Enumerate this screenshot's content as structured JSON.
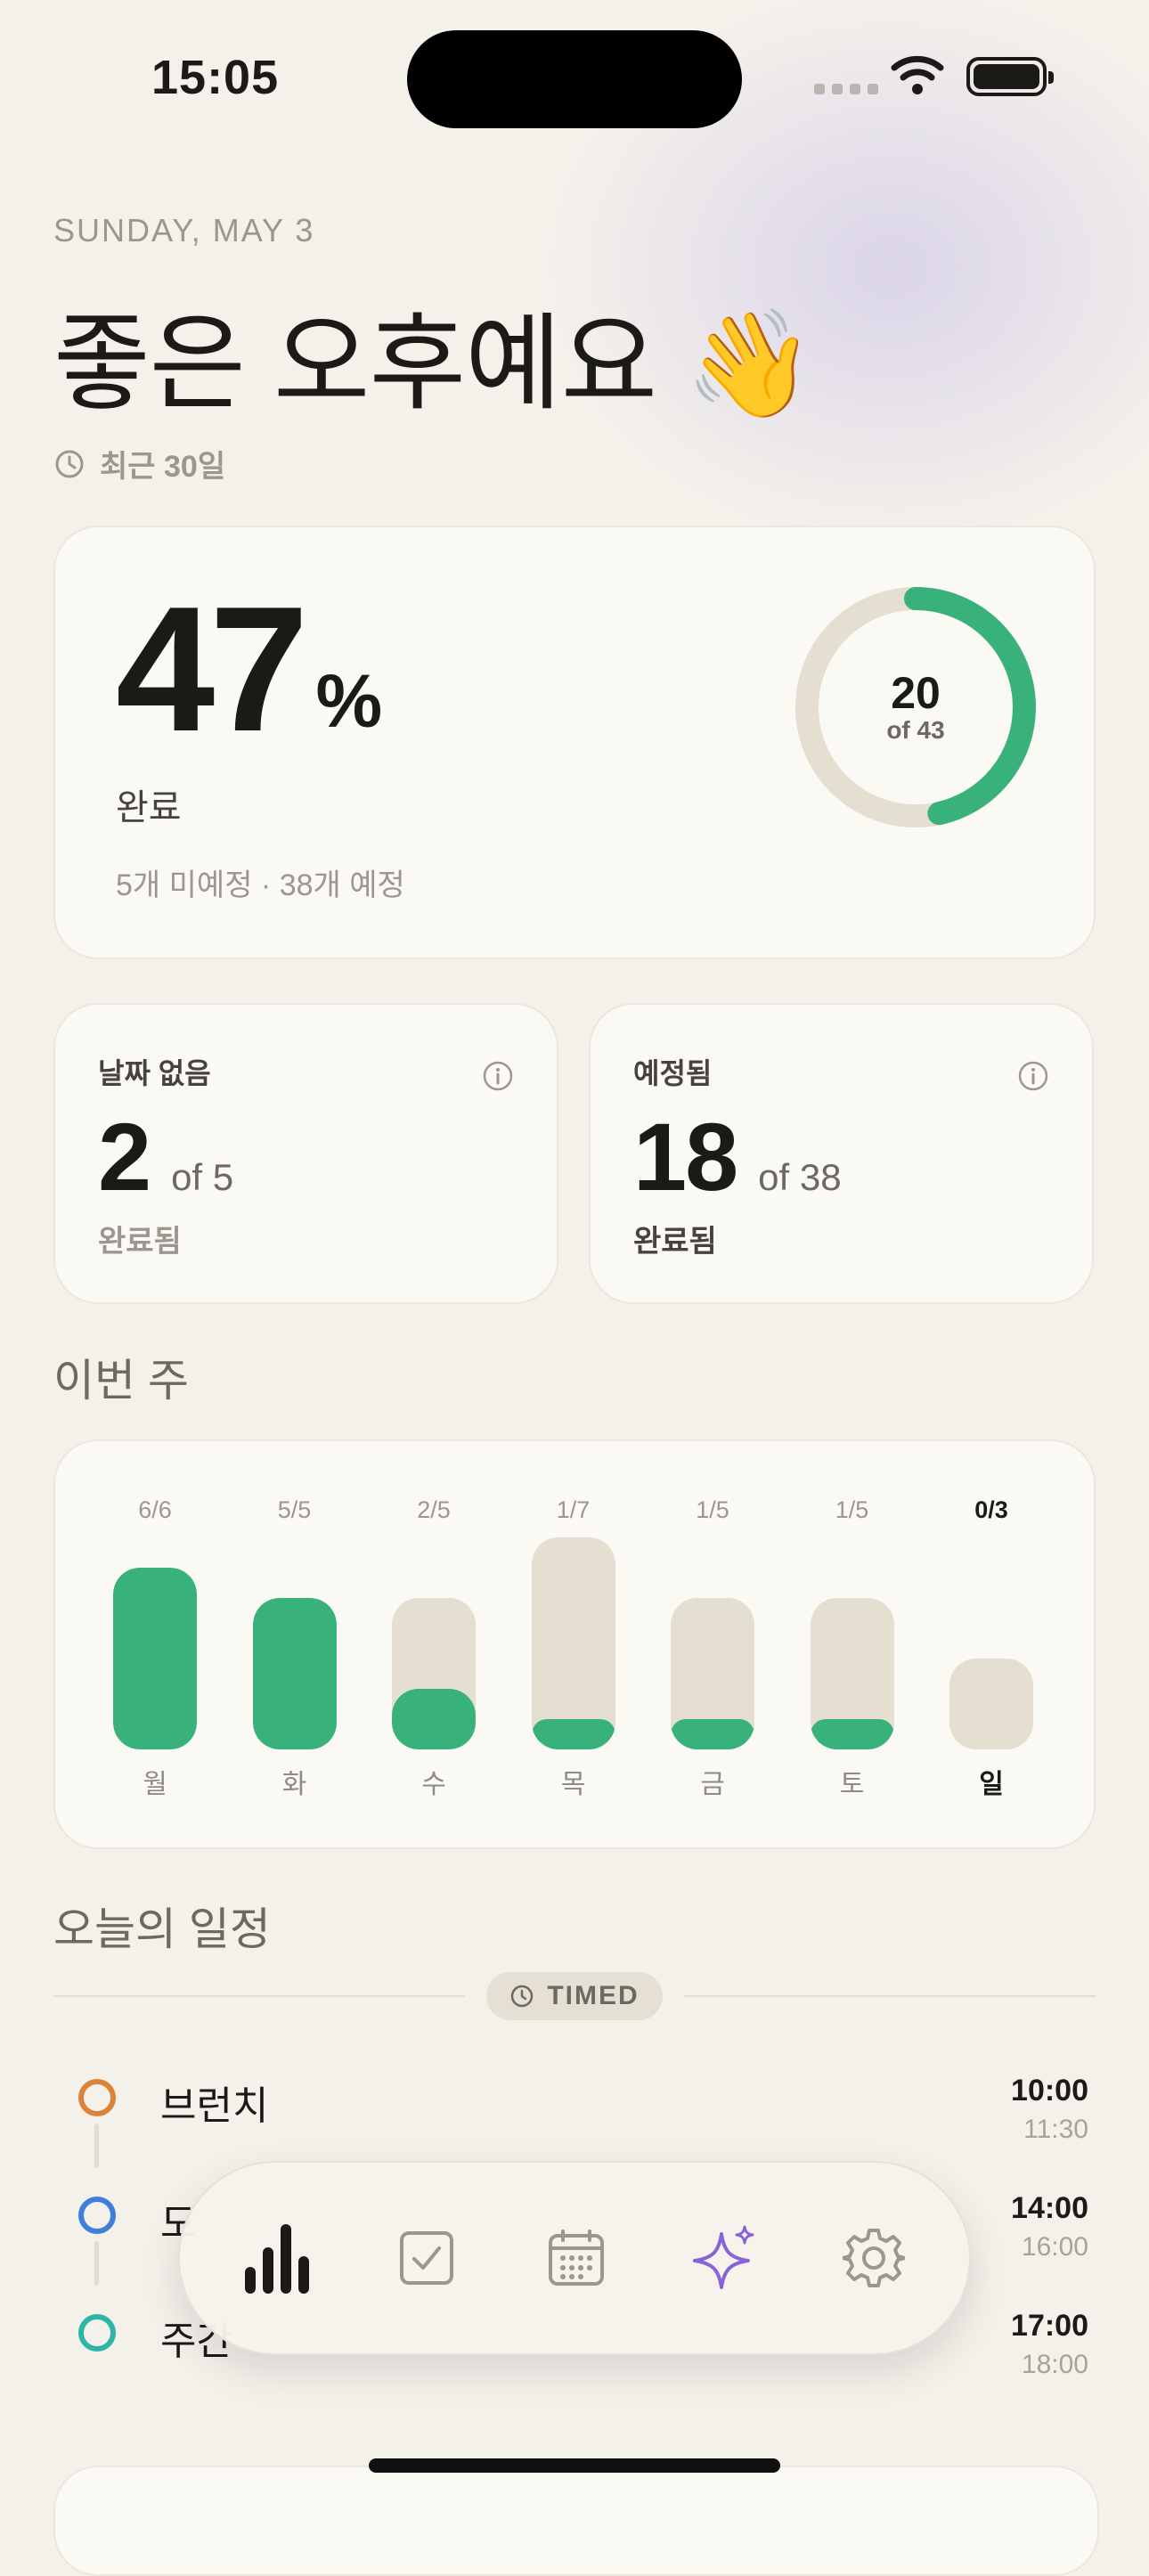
{
  "status_bar": {
    "time": "15:05"
  },
  "header": {
    "date": "SUNDAY, MAY 3",
    "greeting": "좋은 오후예요 👋",
    "range_label": "최근 30일"
  },
  "summary": {
    "percent": "47",
    "percent_sign": "%",
    "label": "완료",
    "sub": "5개 미예정 · 38개 예정",
    "ring_count": "20",
    "ring_of": "of 43",
    "completed": 20,
    "total": 43
  },
  "stats": [
    {
      "title": "날짜 없음",
      "value": "2",
      "of": "of 5",
      "footer": "완료됨"
    },
    {
      "title": "예정됨",
      "value": "18",
      "of": "of 38",
      "footer": "완료됨"
    }
  ],
  "week": {
    "title": "이번 주",
    "days": [
      {
        "day": "월",
        "count": "6/6",
        "done": 6,
        "total": 6
      },
      {
        "day": "화",
        "count": "5/5",
        "done": 5,
        "total": 5
      },
      {
        "day": "수",
        "count": "2/5",
        "done": 2,
        "total": 5
      },
      {
        "day": "목",
        "count": "1/7",
        "done": 1,
        "total": 7
      },
      {
        "day": "금",
        "count": "1/5",
        "done": 1,
        "total": 5
      },
      {
        "day": "토",
        "count": "1/5",
        "done": 1,
        "total": 5
      },
      {
        "day": "일",
        "count": "0/3",
        "done": 0,
        "total": 3,
        "today": true
      }
    ]
  },
  "schedule": {
    "title": "오늘의 일정",
    "group_label": "TIMED",
    "events": [
      {
        "title": "브런치",
        "start": "10:00",
        "end": "11:30",
        "color": "#d9843a"
      },
      {
        "title": "도",
        "start": "14:00",
        "end": "16:00",
        "color": "#3f7fdc"
      },
      {
        "title": "주간",
        "start": "17:00",
        "end": "18:00",
        "color": "#2fb5a5"
      }
    ]
  },
  "colors": {
    "accent": "#38b27a",
    "track": "#e5dfd1",
    "sparkle": "#8a62d6"
  },
  "tabbar": {
    "tabs": [
      "stats-icon",
      "checklist-icon",
      "calendar-icon",
      "sparkles-icon",
      "gear-icon"
    ]
  }
}
